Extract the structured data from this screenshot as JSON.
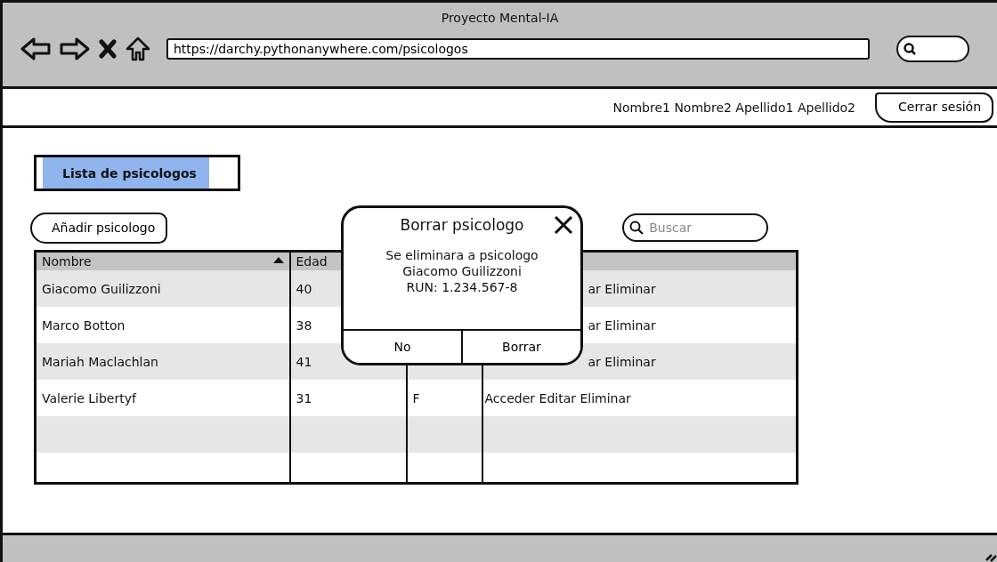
{
  "window": {
    "title": "Proyecto Mental-IA",
    "url": "https://darchy.pythonanywhere.com/psicologos"
  },
  "user_bar": {
    "user_name": "Nombre1 Nombre2 Apellido1 Apellido2",
    "logout_button": "Cerrar sesión"
  },
  "page_title": "Lista de psicologos",
  "add_button": "Añadir psicologo",
  "search": {
    "placeholder": "Buscar"
  },
  "table": {
    "columns": [
      {
        "label": "Nombre",
        "sorted": true
      },
      {
        "label": "Edad"
      }
    ],
    "rows": [
      {
        "nombre": "Giacomo Guilizzoni",
        "edad": "40",
        "column_4": "ar Eliminar",
        "column_4_covered": true
      },
      {
        "nombre": "Marco Botton",
        "edad": "38",
        "column_4": "ar Eliminar",
        "column_4_covered": true
      },
      {
        "nombre": "Mariah Maclachlan",
        "edad": "41",
        "column_4": "ar Eliminar",
        "column_4_covered": true
      },
      {
        "nombre": "Valerie Libertyf",
        "edad": "31",
        "column_3": "F",
        "column_4": "Acceder Editar Eliminar"
      }
    ]
  },
  "dialog": {
    "title": "Borrar psicologo",
    "message": [
      "Se eliminara a psicologo",
      "Giacomo Guilizzoni",
      "RUN: 1.234.567-8"
    ],
    "buttons": [
      "No",
      "Borrar"
    ]
  }
}
